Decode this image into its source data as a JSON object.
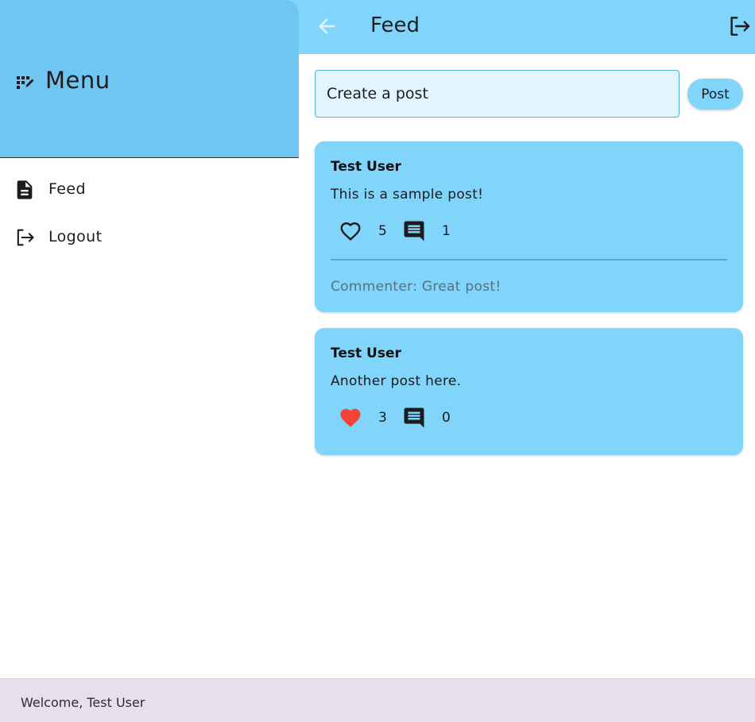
{
  "appbar": {
    "title": "Feed",
    "back_icon": "arrow-left-icon",
    "logout_icon": "logout-icon"
  },
  "composer": {
    "placeholder": "Create a post",
    "post_label": "Post"
  },
  "posts": [
    {
      "author": "Test User",
      "content": "This is a sample post!",
      "liked": false,
      "likes": "5",
      "comments_count": "1",
      "comments": [
        "Commenter: Great post!"
      ]
    },
    {
      "author": "Test User",
      "content": "Another post here.",
      "liked": true,
      "likes": "3",
      "comments_count": "0",
      "comments": []
    }
  ],
  "drawer": {
    "title": "Menu",
    "title_icon": "menu-edit-icon",
    "items": [
      {
        "label": "Feed",
        "icon": "article-icon"
      },
      {
        "label": "Logout",
        "icon": "logout-icon"
      }
    ]
  },
  "footer": {
    "welcome": "Welcome, Test User"
  },
  "colors": {
    "appbar": "#81d4fa",
    "card": "#81d4fa",
    "drawer_header": "#6ec6f1",
    "liked_heart": "#f44336",
    "bottom_bar": "#e7e0ec"
  }
}
